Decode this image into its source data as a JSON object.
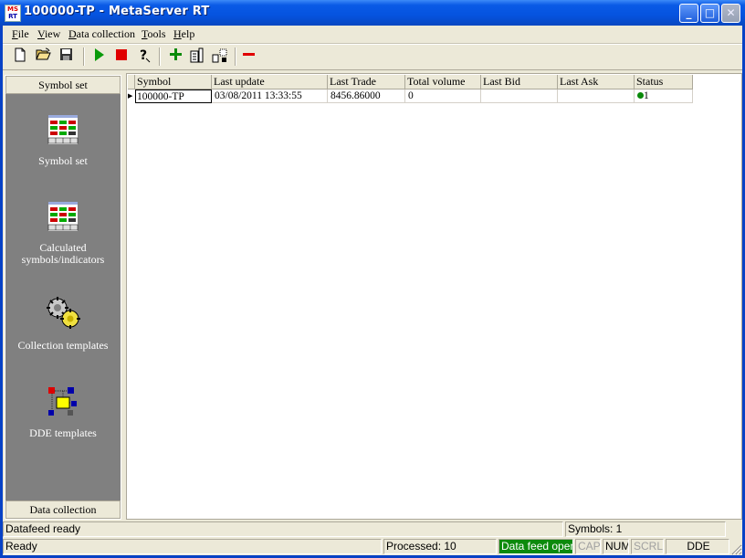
{
  "window": {
    "title": "100000-TP - MetaServer RT",
    "icon_top": "MS",
    "icon_bottom": "RT"
  },
  "menu": [
    {
      "prefix": "",
      "ul": "F",
      "rest": "ile"
    },
    {
      "prefix": "",
      "ul": "V",
      "rest": "iew"
    },
    {
      "prefix": "",
      "ul": "D",
      "rest": "ata collection"
    },
    {
      "prefix": "",
      "ul": "T",
      "rest": "ools"
    },
    {
      "prefix": "",
      "ul": "H",
      "rest": "elp"
    }
  ],
  "toolbar": {
    "icons": [
      "new-file-icon",
      "open-folder-icon",
      "save-disk-icon",
      "play-icon",
      "stop-icon",
      "help-icon",
      "add-icon",
      "properties-icon",
      "columns-icon",
      "remove-icon"
    ],
    "colors": {
      "play": "#0a9a0a",
      "stop": "#e00000",
      "add": "#0a8a0a",
      "remove": "#e00000"
    }
  },
  "sidebar": {
    "top_header": "Symbol set",
    "bottom_header": "Data collection",
    "items": [
      {
        "label": "Symbol set",
        "icon": "symbol-set-icon"
      },
      {
        "label": "Calculated symbols/indicators",
        "icon": "calculated-symbols-icon"
      },
      {
        "label": "Collection templates",
        "icon": "collection-templates-icon"
      },
      {
        "label": "DDE templates",
        "icon": "dde-templates-icon"
      }
    ]
  },
  "grid": {
    "columns": [
      "Symbol",
      "Last update",
      "Last Trade",
      "Total volume",
      "Last Bid",
      "Last Ask",
      "Status"
    ],
    "rows": [
      {
        "symbol": "100000-TP",
        "last_update": "03/08/2011 13:33:55",
        "last_trade": "8456.86000",
        "total_volume": "0",
        "last_bid": "",
        "last_ask": "",
        "status": "1",
        "status_color": "#0a8a0a"
      }
    ]
  },
  "status": {
    "line1_left": "Datafeed ready",
    "line1_right": "Symbols: 1",
    "line2_left": "Ready",
    "processed": "Processed: 10",
    "feed": "Data feed opened",
    "cap": "CAP",
    "num": "NUM",
    "scrl": "SCRL",
    "dde": "DDE"
  }
}
